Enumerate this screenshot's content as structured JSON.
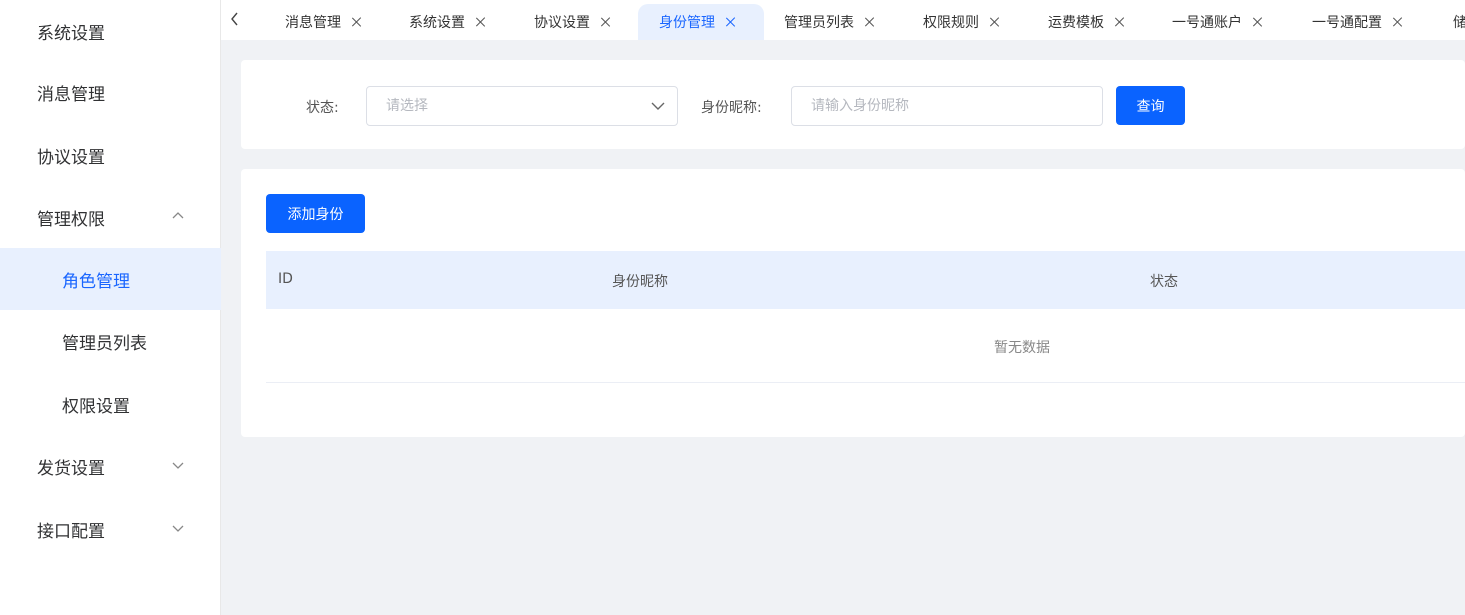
{
  "sidebar": {
    "items": [
      {
        "label": "系统设置"
      },
      {
        "label": "消息管理"
      },
      {
        "label": "协议设置"
      },
      {
        "label": "管理权限"
      },
      {
        "label": "角色管理"
      },
      {
        "label": "管理员列表"
      },
      {
        "label": "权限设置"
      },
      {
        "label": "发货设置"
      },
      {
        "label": "接口配置"
      }
    ]
  },
  "tabs": [
    {
      "label": "消息管理"
    },
    {
      "label": "系统设置"
    },
    {
      "label": "协议设置"
    },
    {
      "label": "身份管理"
    },
    {
      "label": "管理员列表"
    },
    {
      "label": "权限规则"
    },
    {
      "label": "运费模板"
    },
    {
      "label": "一号通账户"
    },
    {
      "label": "一号通配置"
    },
    {
      "label": "储"
    }
  ],
  "filter": {
    "status_label": "状态:",
    "status_placeholder": "请选择",
    "nickname_label": "身份昵称:",
    "nickname_placeholder": "请输入身份昵称",
    "query_button": "查询"
  },
  "table": {
    "add_button": "添加身份",
    "columns": [
      "ID",
      "身份昵称",
      "状态"
    ],
    "empty_text": "暂无数据"
  },
  "colors": {
    "accent": "#0a63ff",
    "active_bg": "#e8f0fe"
  }
}
